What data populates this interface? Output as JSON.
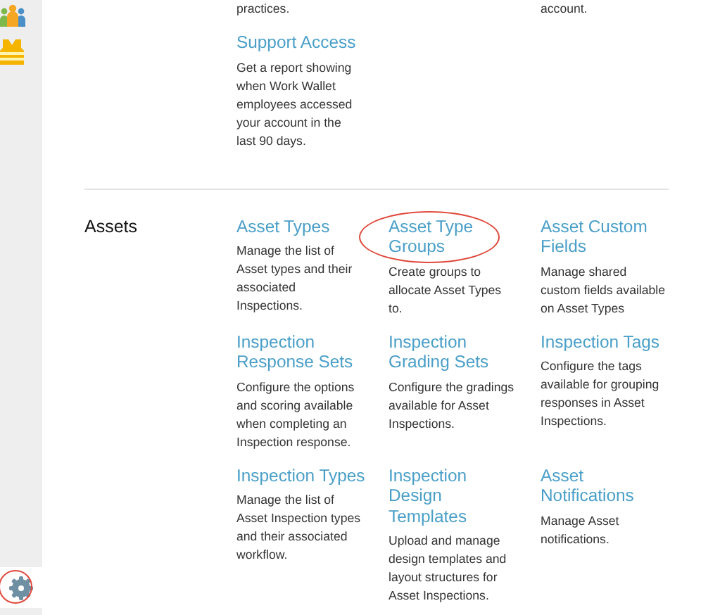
{
  "sidebar": {
    "items": [
      {
        "kind": "people"
      },
      {
        "kind": "vest"
      }
    ],
    "footer": {
      "kind": "settings",
      "highlighted": true
    }
  },
  "previous_section": {
    "rows": [
      [
        {
          "description": "practices."
        },
        null,
        {
          "description": "account."
        }
      ],
      [
        {
          "title": "Support Access",
          "description": "Get a report showing when Work Wallet employees accessed your account in the last 90 days."
        }
      ]
    ]
  },
  "assets_section": {
    "label": "Assets",
    "items": [
      {
        "title": "Asset Types",
        "description": "Manage the list of Asset types and their associated Inspections.",
        "highlighted": false
      },
      {
        "title": "Asset Type Groups",
        "description": "Create groups to allocate Asset Types to.",
        "highlighted": true
      },
      {
        "title": "Asset Custom Fields",
        "description": "Manage shared custom fields available on Asset Types",
        "highlighted": false
      },
      {
        "title": "Inspection Response Sets",
        "description": "Configure the options and scoring available when completing an Inspection response.",
        "highlighted": false
      },
      {
        "title": "Inspection Grading Sets",
        "description": "Configure the gradings available for Asset Inspections.",
        "highlighted": false
      },
      {
        "title": "Inspection Tags",
        "description": "Configure the tags available for grouping responses in Asset Inspections.",
        "highlighted": false
      },
      {
        "title": "Inspection Types",
        "description": "Manage the list of Asset Inspection types and their associated workflow.",
        "highlighted": false
      },
      {
        "title": "Inspection Design Templates",
        "description": "Upload and manage design templates and layout structures for Asset Inspections.",
        "highlighted": false
      },
      {
        "title": "Asset Notifications",
        "description": "Manage Asset notifications.",
        "highlighted": false
      }
    ]
  }
}
